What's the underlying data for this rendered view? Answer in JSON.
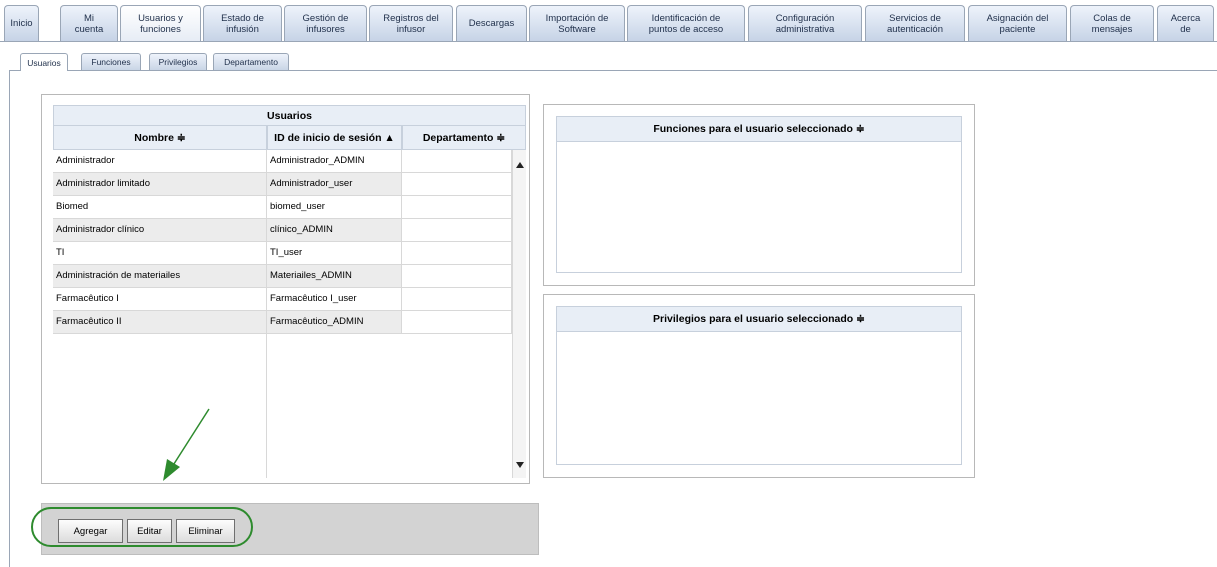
{
  "nav": {
    "tabs": [
      {
        "label": "Inicio"
      },
      {
        "label": "Mi\ncuenta"
      },
      {
        "label": "Usuarios y\nfunciones"
      },
      {
        "label": "Estado de\ninfusión"
      },
      {
        "label": "Gestión de\ninfusores"
      },
      {
        "label": "Registros del\ninfusor"
      },
      {
        "label": "Descargas"
      },
      {
        "label": "Importación de\nSoftware"
      },
      {
        "label": "Identificación de\npuntos de acceso"
      },
      {
        "label": "Configuración\nadministrativa"
      },
      {
        "label": "Servicios de\nautenticación"
      },
      {
        "label": "Asignación del\npaciente"
      },
      {
        "label": "Colas de\nmensajes"
      },
      {
        "label": "Acerca\nde"
      }
    ],
    "active": "Usuarios y funciones"
  },
  "subtabs": [
    {
      "label": "Usuarios"
    },
    {
      "label": "Funciones"
    },
    {
      "label": "Privilegios"
    },
    {
      "label": "Departamento"
    }
  ],
  "users_table": {
    "title": "Usuarios",
    "columns": [
      "Nombre ≑",
      "ID de inicio de sesión ▲",
      "Departamento ≑"
    ],
    "rows": [
      [
        "Administrador",
        "Administrador_ADMIN",
        ""
      ],
      [
        "Administrador limitado",
        "Administrador_user",
        ""
      ],
      [
        "Biomed",
        "biomed_user",
        ""
      ],
      [
        "Administrador clínico",
        "clínico_ADMIN",
        ""
      ],
      [
        "TI",
        "TI_user",
        ""
      ],
      [
        "Administración de materiailes",
        "Materiailes_ADMIN",
        ""
      ],
      [
        "Farmacêutico I",
        "Farmacêutico I_user",
        ""
      ],
      [
        "Farmacêutico II",
        "Farmacêutico_ADMIN",
        ""
      ]
    ]
  },
  "roles_panel": {
    "title": "Funciones para el usuario seleccionado ≑"
  },
  "privileges_panel": {
    "title": "Privilegios para el usuario seleccionado ≑"
  },
  "buttons": {
    "add": "Agregar",
    "edit": "Editar",
    "delete": "Eliminar"
  },
  "colors": {
    "highlight": "#2e8b2e",
    "tab_text": "#1f2f4a"
  }
}
